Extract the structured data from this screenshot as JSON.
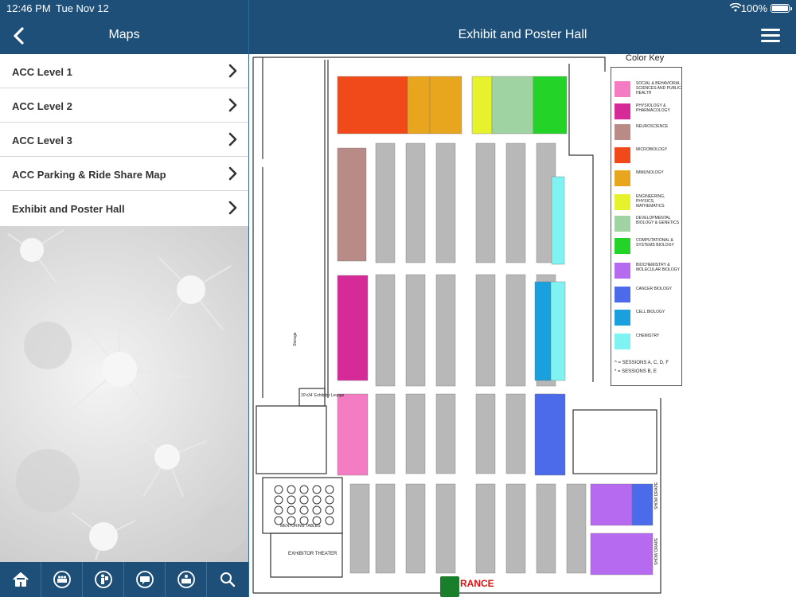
{
  "status_bar": {
    "time": "12:46 PM",
    "date": "Tue Nov 12",
    "battery": "100%"
  },
  "left_panel": {
    "title": "Maps",
    "items": [
      {
        "label": "ACC Level 1"
      },
      {
        "label": "ACC Level 2"
      },
      {
        "label": "ACC Level 3"
      },
      {
        "label": "ACC Parking & Ride Share Map"
      },
      {
        "label": "Exhibit and Poster Hall"
      }
    ]
  },
  "right_panel": {
    "title": "Exhibit and Poster Hall"
  },
  "toolbar": {
    "icons": [
      "home-icon",
      "meetings-icon",
      "presenter-icon",
      "message-icon",
      "exhibitor-icon",
      "search-icon"
    ]
  },
  "map": {
    "legend_title": "Color Key",
    "legend": [
      {
        "label": "SOCIAL & BEHAVIORAL SCIENCES AND PUBLIC HEALTH",
        "color": "#f47cc2"
      },
      {
        "label": "PHYSIOLOGY & PHARMACOLOGY",
        "color": "#d72a99"
      },
      {
        "label": "NEUROSCIENCE",
        "color": "#b98b86"
      },
      {
        "label": "MICROBIOLOGY",
        "color": "#f04a1a"
      },
      {
        "label": "IMMUNOLOGY",
        "color": "#e8a51e"
      },
      {
        "label": "ENGINEERING, PHYSICS, MATHEMATICS",
        "color": "#e6f22b"
      },
      {
        "label": "DEVELOPMENTAL BIOLOGY & GENETICS",
        "color": "#9fd3a2"
      },
      {
        "label": "COMPUTATIONAL & SYSTEMS BIOLOGY",
        "color": "#23d328"
      },
      {
        "label": "BIOCHEMISTRY & MOLECULAR BIOLOGY",
        "color": "#b56af0"
      },
      {
        "label": "CANCER BIOLOGY",
        "color": "#4b6bea"
      },
      {
        "label": "CELL BIOLOGY",
        "color": "#1aa0dc"
      },
      {
        "label": "CHEMISTRY",
        "color": "#7ff2f2"
      }
    ],
    "notes": [
      "^ = SESSIONS A, C, D, F",
      "* = SESSIONS B, E"
    ],
    "lounge_label": "20'x34' Exhibitor Lounge",
    "mentoring_label": "MENTORING TABLES",
    "theater_label": "EXHIBITOR THEATER",
    "storage_label": "Storage",
    "show_drape_label": "SHOW DRAPE",
    "entrance_label": "RANCE"
  }
}
